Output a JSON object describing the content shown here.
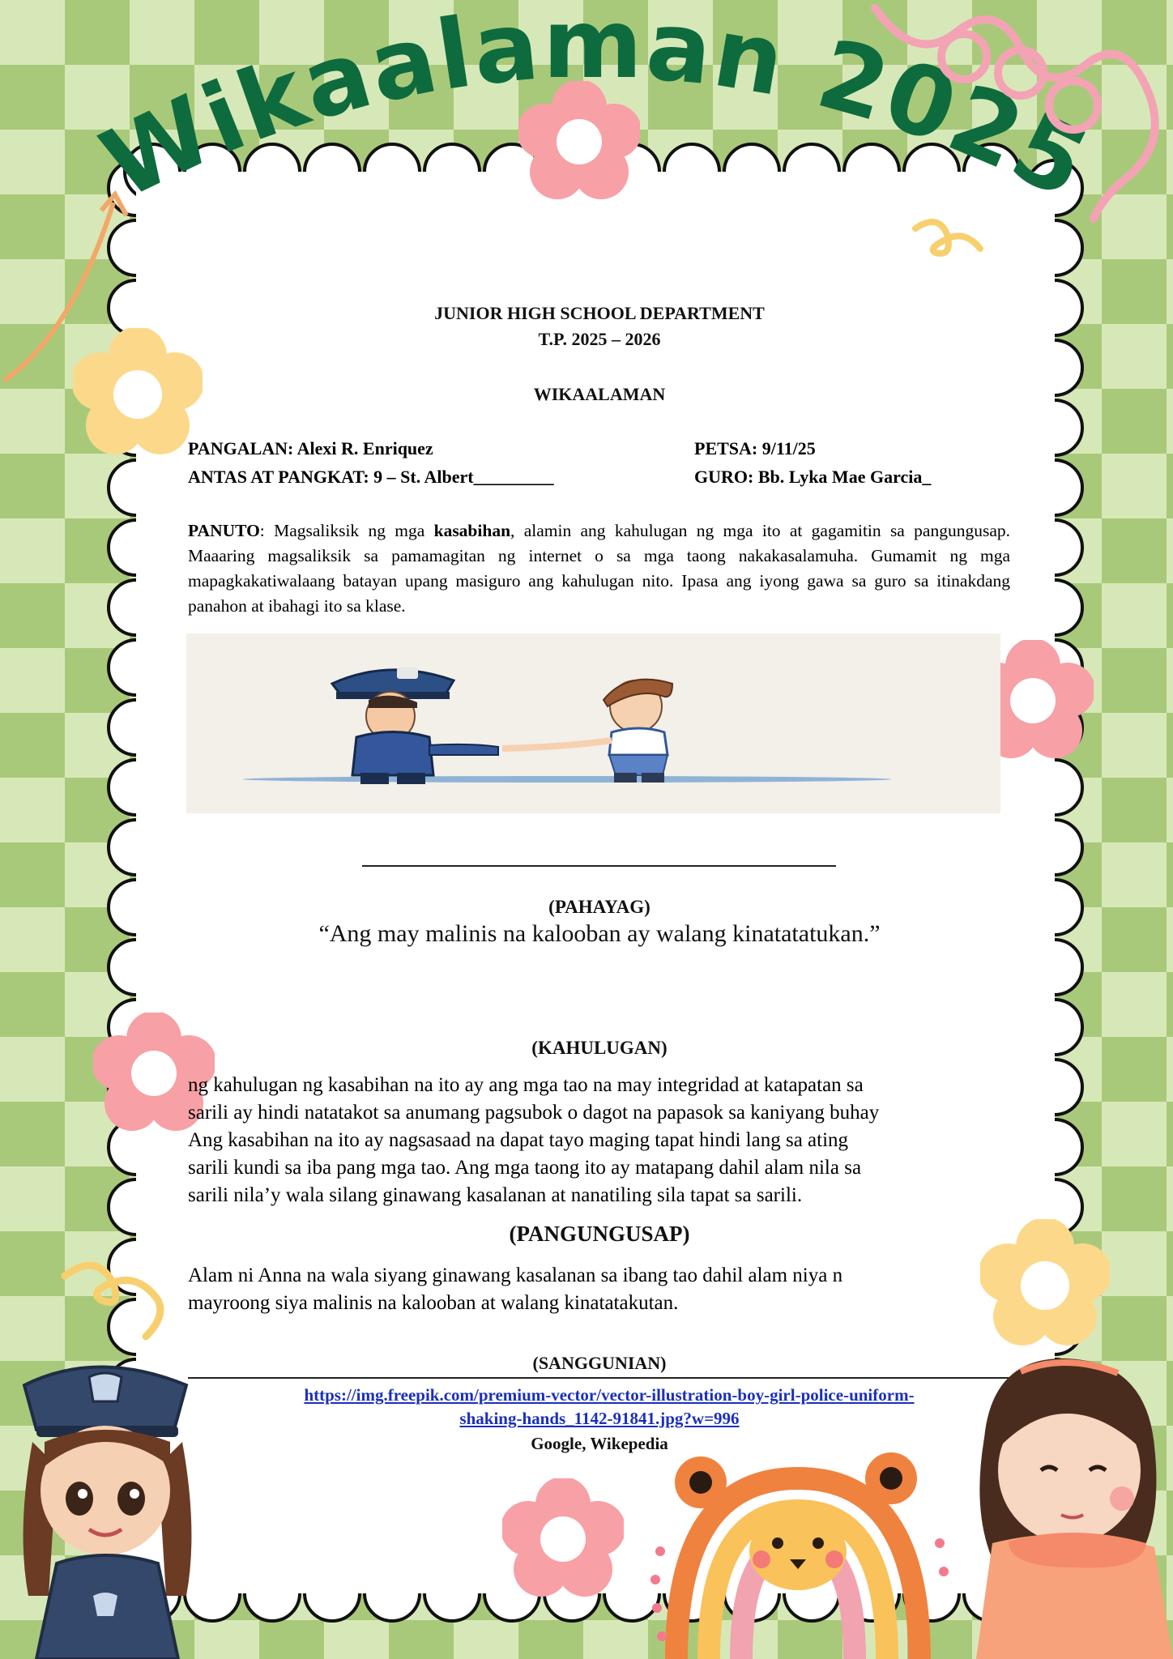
{
  "banner": {
    "title": "Wikaalaman 2025"
  },
  "header": {
    "department": "JUNIOR HIGH SCHOOL DEPARTMENT",
    "school_year": "T.P. 2025 – 2026",
    "subject": "WIKAALAMAN"
  },
  "fields": {
    "name": "PANGALAN: Alexi R. Enriquez",
    "date": "PETSA: 9/11/25",
    "grade_section": "ANTAS AT PANGKAT: 9 – St. Albert_________",
    "teacher": "GURO: Bb. Lyka Mae Garcia_"
  },
  "instructions": {
    "label": "PANUTO",
    "text_before": ": Magsaliksik ng mga ",
    "keyword": "kasabihan",
    "text_after": ", alamin ang kahulugan ng mga ito at gagamitin sa pangungusap. Maaaring magsaliksik sa pamamagitan ng internet o sa mga taong nakakasalamuha. Gumamit ng mga mapagkakatiwalaang batayan upang masiguro ang kahulugan nito. Ipasa ang iyong gawa sa guro sa itinakdang panahon at ibahagi ito sa klase."
  },
  "illustration": {
    "subject": "police officer shaking hands with a boy"
  },
  "statement": {
    "title": "(PAHAYAG)",
    "text": "“Ang may malinis na kalooban ay walang kinatatatukan.”"
  },
  "meaning": {
    "title": "(KAHULUGAN)",
    "lines": [
      "ng kahulugan ng kasabihan na ito ay ang mga tao na may integridad at katapatan sa",
      "sarili ay hindi natatakot sa anumang pagsubok o dagot na papasok sa kaniyang buhay",
      "Ang kasabihan na ito ay nagsasaad na dapat tayo maging tapat hindi lang sa ating",
      "sarili kundi sa iba pang mga tao. Ang mga taong ito ay matapang dahil alam nila sa",
      "sarili nila’y wala silang ginawang kasalanan at nanatiling sila tapat sa sarili."
    ]
  },
  "sentence": {
    "title": "(PANGUNGUSAP)",
    "lines": [
      "Alam ni Anna na wala siyang ginawang kasalanan sa ibang tao dahil alam niya n",
      "mayroong siya malinis na kalooban at walang kinatatakutan."
    ]
  },
  "references": {
    "title": "(SANGGUNIAN)",
    "link_line1": "https://img.freepik.com/premium-vector/vector-illustration-boy-girl-police-uniform-",
    "link_line2": "shaking-hands_1142-91841.jpg?w=996",
    "sources": "Google, Wikepedia"
  },
  "colors": {
    "title_green": "#0e6b3e",
    "check_dark": "#a9c97a",
    "check_light": "#d7e8b8",
    "flower_pink": "#f7a0a6",
    "flower_yellow": "#fcd98a",
    "link_blue": "#1a2fbf"
  }
}
